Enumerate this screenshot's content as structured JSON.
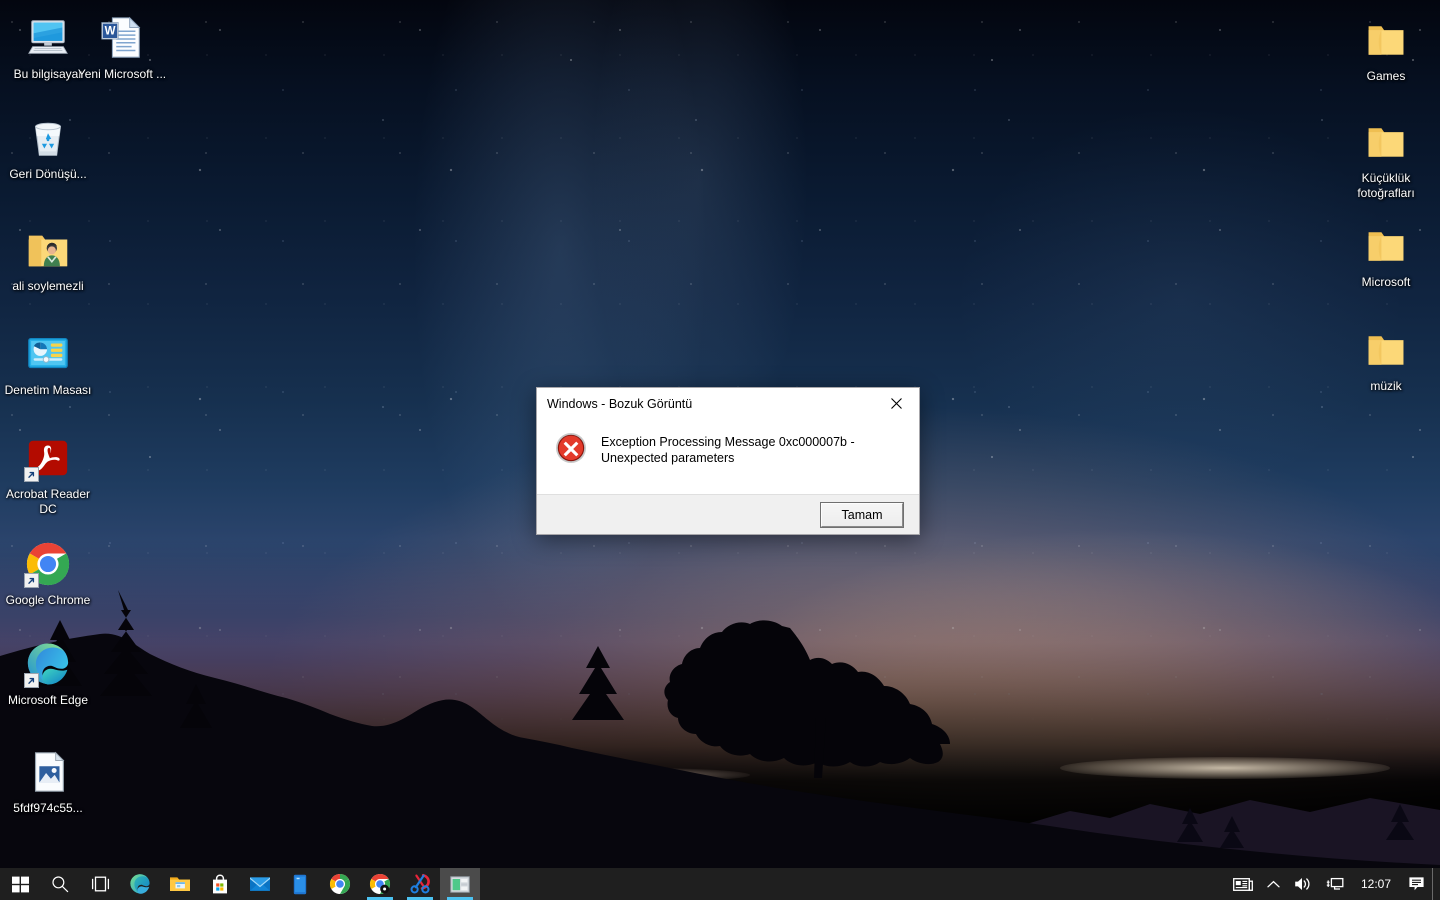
{
  "desktop": {
    "icons_left": [
      {
        "name": "this-pc",
        "label": "Bu bilgisayar",
        "icon": "computer-monitor-icon",
        "shortcut": false
      },
      {
        "name": "word-document",
        "label": "Yeni Microsoft ...",
        "icon": "word-document-icon",
        "shortcut": false
      },
      {
        "name": "recycle-bin",
        "label": "Geri Dönüşü...",
        "icon": "recycle-bin-icon",
        "shortcut": false
      },
      {
        "name": "user-folder",
        "label": "ali soylemezli",
        "icon": "user-folder-icon",
        "shortcut": false
      },
      {
        "name": "control-panel",
        "label": "Denetim Masası",
        "icon": "control-panel-icon",
        "shortcut": false
      },
      {
        "name": "acrobat-reader",
        "label": "Acrobat Reader DC",
        "icon": "acrobat-reader-icon",
        "shortcut": true
      },
      {
        "name": "google-chrome",
        "label": "Google Chrome",
        "icon": "google-chrome-icon",
        "shortcut": true
      },
      {
        "name": "microsoft-edge",
        "label": "Microsoft Edge",
        "icon": "microsoft-edge-icon",
        "shortcut": true
      },
      {
        "name": "image-file",
        "label": "5fdf974c55...",
        "icon": "image-file-icon",
        "shortcut": false
      }
    ],
    "icons_right": [
      {
        "name": "folder-games",
        "label": "Games",
        "icon": "folder-icon"
      },
      {
        "name": "folder-thumbnails",
        "label": "Küçüklük fotoğrafları",
        "icon": "folder-icon"
      },
      {
        "name": "folder-microsoft",
        "label": "Microsoft",
        "icon": "folder-icon"
      },
      {
        "name": "folder-music",
        "label": "müzik",
        "icon": "folder-icon"
      }
    ]
  },
  "dialog": {
    "title": "Windows - Bozuk Görüntü",
    "close_icon": "close-icon",
    "error_icon": "error-circle-icon",
    "message": "Exception Processing Message 0xc000007b - Unexpected parameters",
    "ok_label": "Tamam"
  },
  "taskbar": {
    "start": {
      "name": "start-button",
      "icon": "windows-logo-icon"
    },
    "search": {
      "name": "search-button",
      "icon": "search-icon"
    },
    "task_view": {
      "name": "task-view-button",
      "icon": "task-view-icon"
    },
    "pinned": [
      {
        "name": "taskbar-edge",
        "icon": "microsoft-edge-icon",
        "running": false
      },
      {
        "name": "taskbar-explorer",
        "icon": "file-explorer-icon",
        "running": false
      },
      {
        "name": "taskbar-store",
        "icon": "microsoft-store-icon",
        "running": false
      },
      {
        "name": "taskbar-mail",
        "icon": "mail-icon",
        "running": false
      },
      {
        "name": "taskbar-phone-link",
        "icon": "phone-link-icon",
        "running": false
      },
      {
        "name": "taskbar-chrome",
        "icon": "google-chrome-icon",
        "running": false
      },
      {
        "name": "taskbar-chrome-2",
        "icon": "google-chrome-icon",
        "running": true
      },
      {
        "name": "taskbar-snipping-tool",
        "icon": "snipping-tool-icon",
        "running": true
      },
      {
        "name": "taskbar-active-window",
        "icon": "window-app-icon",
        "running": true,
        "active": true
      }
    ],
    "tray": {
      "news_icon": "news-and-interests-icon",
      "chevron_icon": "chevron-up-icon",
      "volume_icon": "speaker-icon",
      "network_icon": "network-monitor-icon",
      "time": "12:07",
      "notifications_icon": "notification-chat-icon"
    }
  },
  "colors": {
    "taskbar_bg": "#1f1f1f",
    "running_indicator": "#4cc2f1",
    "error_red": "#d32216",
    "dialog_bg": "#ffffff",
    "dialog_footer": "#f0f0f0",
    "chrome_blue": "#4285f4",
    "chrome_red": "#ea4335",
    "chrome_yellow": "#fbbc05",
    "chrome_green": "#34a853",
    "folder_yellow": "#fcd878",
    "acrobat_red": "#b30b00"
  }
}
